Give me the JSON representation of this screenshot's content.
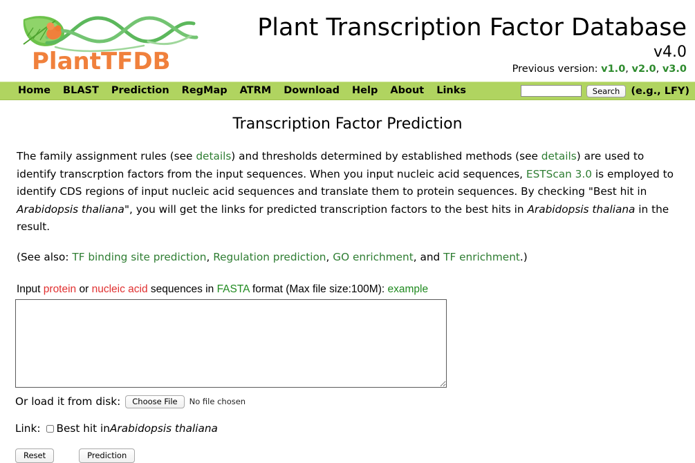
{
  "header": {
    "logo_text": "PlantTFDB",
    "logo_alt": "plant-leaf-dna-logo",
    "site_title": "Plant Transcription Factor Database",
    "version": "v4.0",
    "previous_version_label": "Previous version:",
    "previous_versions": [
      "v1.0",
      "v2.0",
      "v3.0"
    ],
    "colors": {
      "logo_orange": "#f08040",
      "logo_green": "#5cb85c",
      "nav_green": "#b0d460",
      "link_green": "#2e7d32",
      "link_red": "#e03030"
    }
  },
  "nav": {
    "items": [
      {
        "label": "Home"
      },
      {
        "label": "BLAST"
      },
      {
        "label": "Prediction"
      },
      {
        "label": "RegMap"
      },
      {
        "label": "ATRM"
      },
      {
        "label": "Download"
      },
      {
        "label": "Help"
      },
      {
        "label": "About"
      },
      {
        "label": "Links"
      }
    ],
    "search_value": "",
    "search_placeholder": "",
    "search_button": "Search",
    "search_hint": "(e.g., LFY)"
  },
  "main": {
    "page_title": "Transcription Factor Prediction",
    "paragraph1": {
      "p1": "The family assignment rules (see ",
      "link1": "details",
      "p2": ") and thresholds determined by established methods (see ",
      "link2": "details",
      "p3": ") are used to identify transcrption factors from the input sequences. When you input nucleic acid sequences, ",
      "link3": "ESTScan 3.0",
      "p4": " is employed to identify CDS regions of input nucleic acid sequences and translate them to protein sequences. By checking \"Best hit in ",
      "italic1": "Arabidopsis thaliana",
      "p5": "\", you will get the links for predicted transcription factors to the best hits in ",
      "italic2": "Arabidopsis thaliana",
      "p6": " in the result."
    },
    "paragraph2": {
      "prefix": "(See also: ",
      "link1": "TF binding site prediction",
      "sep1": ", ",
      "link2": "Regulation prediction",
      "sep2": ", ",
      "link3": "GO enrichment",
      "sep3": ", and ",
      "link4": "TF enrichment",
      "suffix": ".)"
    },
    "input_label": {
      "p1": "Input ",
      "link_protein": "protein",
      "p2": " or ",
      "link_nucleic": "nucleic acid",
      "p3": " sequences in ",
      "link_fasta": "FASTA",
      "p4": " format (Max file size:100M): ",
      "link_example": "example"
    },
    "textarea_value": "",
    "textarea_placeholder": "",
    "file_row": {
      "label": "Or load it from disk:",
      "button": "Choose File",
      "status": "No file chosen"
    },
    "link_row": {
      "label": "Link:",
      "checkbox_checked": false,
      "checkbox_text_prefix": "Best hit in ",
      "checkbox_text_italic": "Arabidopsis thaliana"
    },
    "buttons": {
      "reset": "Reset",
      "submit": "Prediction"
    }
  }
}
